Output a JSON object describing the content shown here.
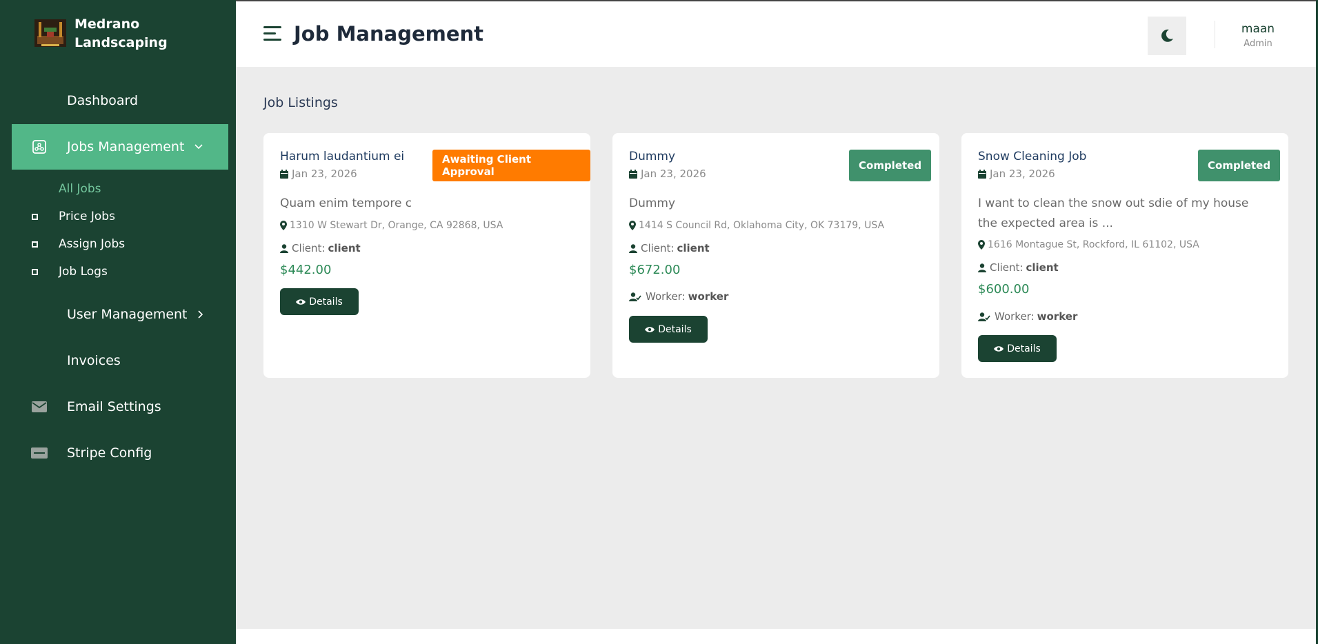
{
  "brand": {
    "name_line1": "Medrano",
    "name_line2": "Landscaping"
  },
  "sidebar": {
    "items": [
      {
        "label": "Dashboard"
      },
      {
        "label": "Jobs Management"
      },
      {
        "label": "User Management"
      },
      {
        "label": "Invoices"
      },
      {
        "label": "Email Settings"
      },
      {
        "label": "Stripe Config"
      }
    ],
    "subitems": [
      {
        "label": "All Jobs"
      },
      {
        "label": "Price Jobs"
      },
      {
        "label": "Assign Jobs"
      },
      {
        "label": "Job Logs"
      }
    ]
  },
  "header": {
    "title": "Job Management"
  },
  "user": {
    "name": "maan",
    "role": "Admin"
  },
  "main": {
    "section_title": "Job Listings"
  },
  "labels": {
    "client": "Client:",
    "worker": "Worker:",
    "details": "Details"
  },
  "jobs": [
    {
      "title": "Harum laudantium ei",
      "date": "Jan 23, 2026",
      "status": "Awaiting Client Approval",
      "status_color": "#ff7b00",
      "description": "Quam enim tempore c",
      "address": "1310 W Stewart Dr, Orange, CA 92868, USA",
      "client": "client",
      "price": "$442.00"
    },
    {
      "title": "Dummy",
      "date": "Jan 23, 2026",
      "status": "Completed",
      "status_color": "#40916c",
      "description": "Dummy",
      "address": "1414 S Council Rd, Oklahoma City, OK 73179, USA",
      "client": "client",
      "price": "$672.00",
      "worker": "worker"
    },
    {
      "title": "Snow Cleaning Job",
      "date": "Jan 23, 2026",
      "status": "Completed",
      "status_color": "#40916c",
      "description": "I want to clean the snow out sdie of my house the expected area is ...",
      "address": "1616 Montague St, Rockford, IL 61102, USA",
      "client": "client",
      "price": "$600.00",
      "worker": "worker"
    }
  ],
  "colors": {
    "sidebar_bg": "#1b4332",
    "active_bg": "#52b788",
    "accent": "#40916c",
    "warning": "#ff7b00"
  }
}
